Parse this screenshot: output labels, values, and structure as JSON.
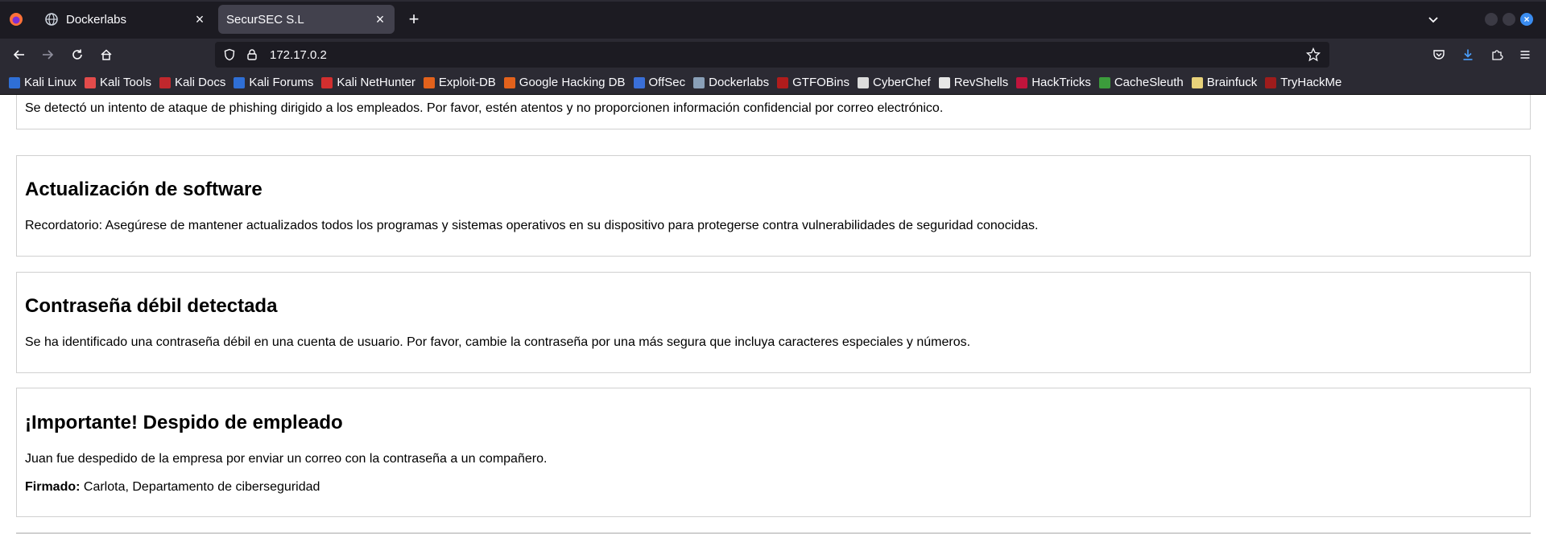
{
  "browser": {
    "tabs": [
      {
        "title": "Dockerlabs",
        "active": false
      },
      {
        "title": "SecurSEC S.L",
        "active": true
      }
    ],
    "url": "172.17.0.2",
    "bookmarks": [
      {
        "label": "Kali Linux",
        "color": "#2f6fd6"
      },
      {
        "label": "Kali Tools",
        "color": "#e24b4b"
      },
      {
        "label": "Kali Docs",
        "color": "#c0282d"
      },
      {
        "label": "Kali Forums",
        "color": "#2f6fd6"
      },
      {
        "label": "Kali NetHunter",
        "color": "#d22f2f"
      },
      {
        "label": "Exploit-DB",
        "color": "#e3621c"
      },
      {
        "label": "Google Hacking DB",
        "color": "#e3621c"
      },
      {
        "label": "OffSec",
        "color": "#3a6fd8"
      },
      {
        "label": "Dockerlabs",
        "color": "#8aa0b8"
      },
      {
        "label": "GTFOBins",
        "color": "#b01c1c"
      },
      {
        "label": "CyberChef",
        "color": "#dcdcdc"
      },
      {
        "label": "RevShells",
        "color": "#e6e6e6"
      },
      {
        "label": "HackTricks",
        "color": "#c0143c"
      },
      {
        "label": "CacheSleuth",
        "color": "#3c9c3c"
      },
      {
        "label": "Brainfuck",
        "color": "#e8d27a"
      },
      {
        "label": "TryHackMe",
        "color": "#9e1c1c"
      }
    ]
  },
  "page": {
    "partial_card": {
      "text": "Se detectó un intento de ataque de phishing dirigido a los empleados. Por favor, estén atentos y no proporcionen información confidencial por correo electrónico."
    },
    "card_software": {
      "title": "Actualización de software",
      "text": "Recordatorio: Asegúrese de mantener actualizados todos los programas y sistemas operativos en su dispositivo para protegerse contra vulnerabilidades de seguridad conocidas."
    },
    "card_password": {
      "title": "Contraseña débil detectada",
      "text": "Se ha identificado una contraseña débil en una cuenta de usuario. Por favor, cambie la contraseña por una más segura que incluya caracteres especiales y números."
    },
    "card_dismissal": {
      "title": "¡Importante! Despido de empleado",
      "text": "Juan fue despedido de la empresa por enviar un correo con la contraseña a un compañero.",
      "signed_label": "Firmado:",
      "signed_value": " Carlota, Departamento de ciberseguridad"
    }
  }
}
